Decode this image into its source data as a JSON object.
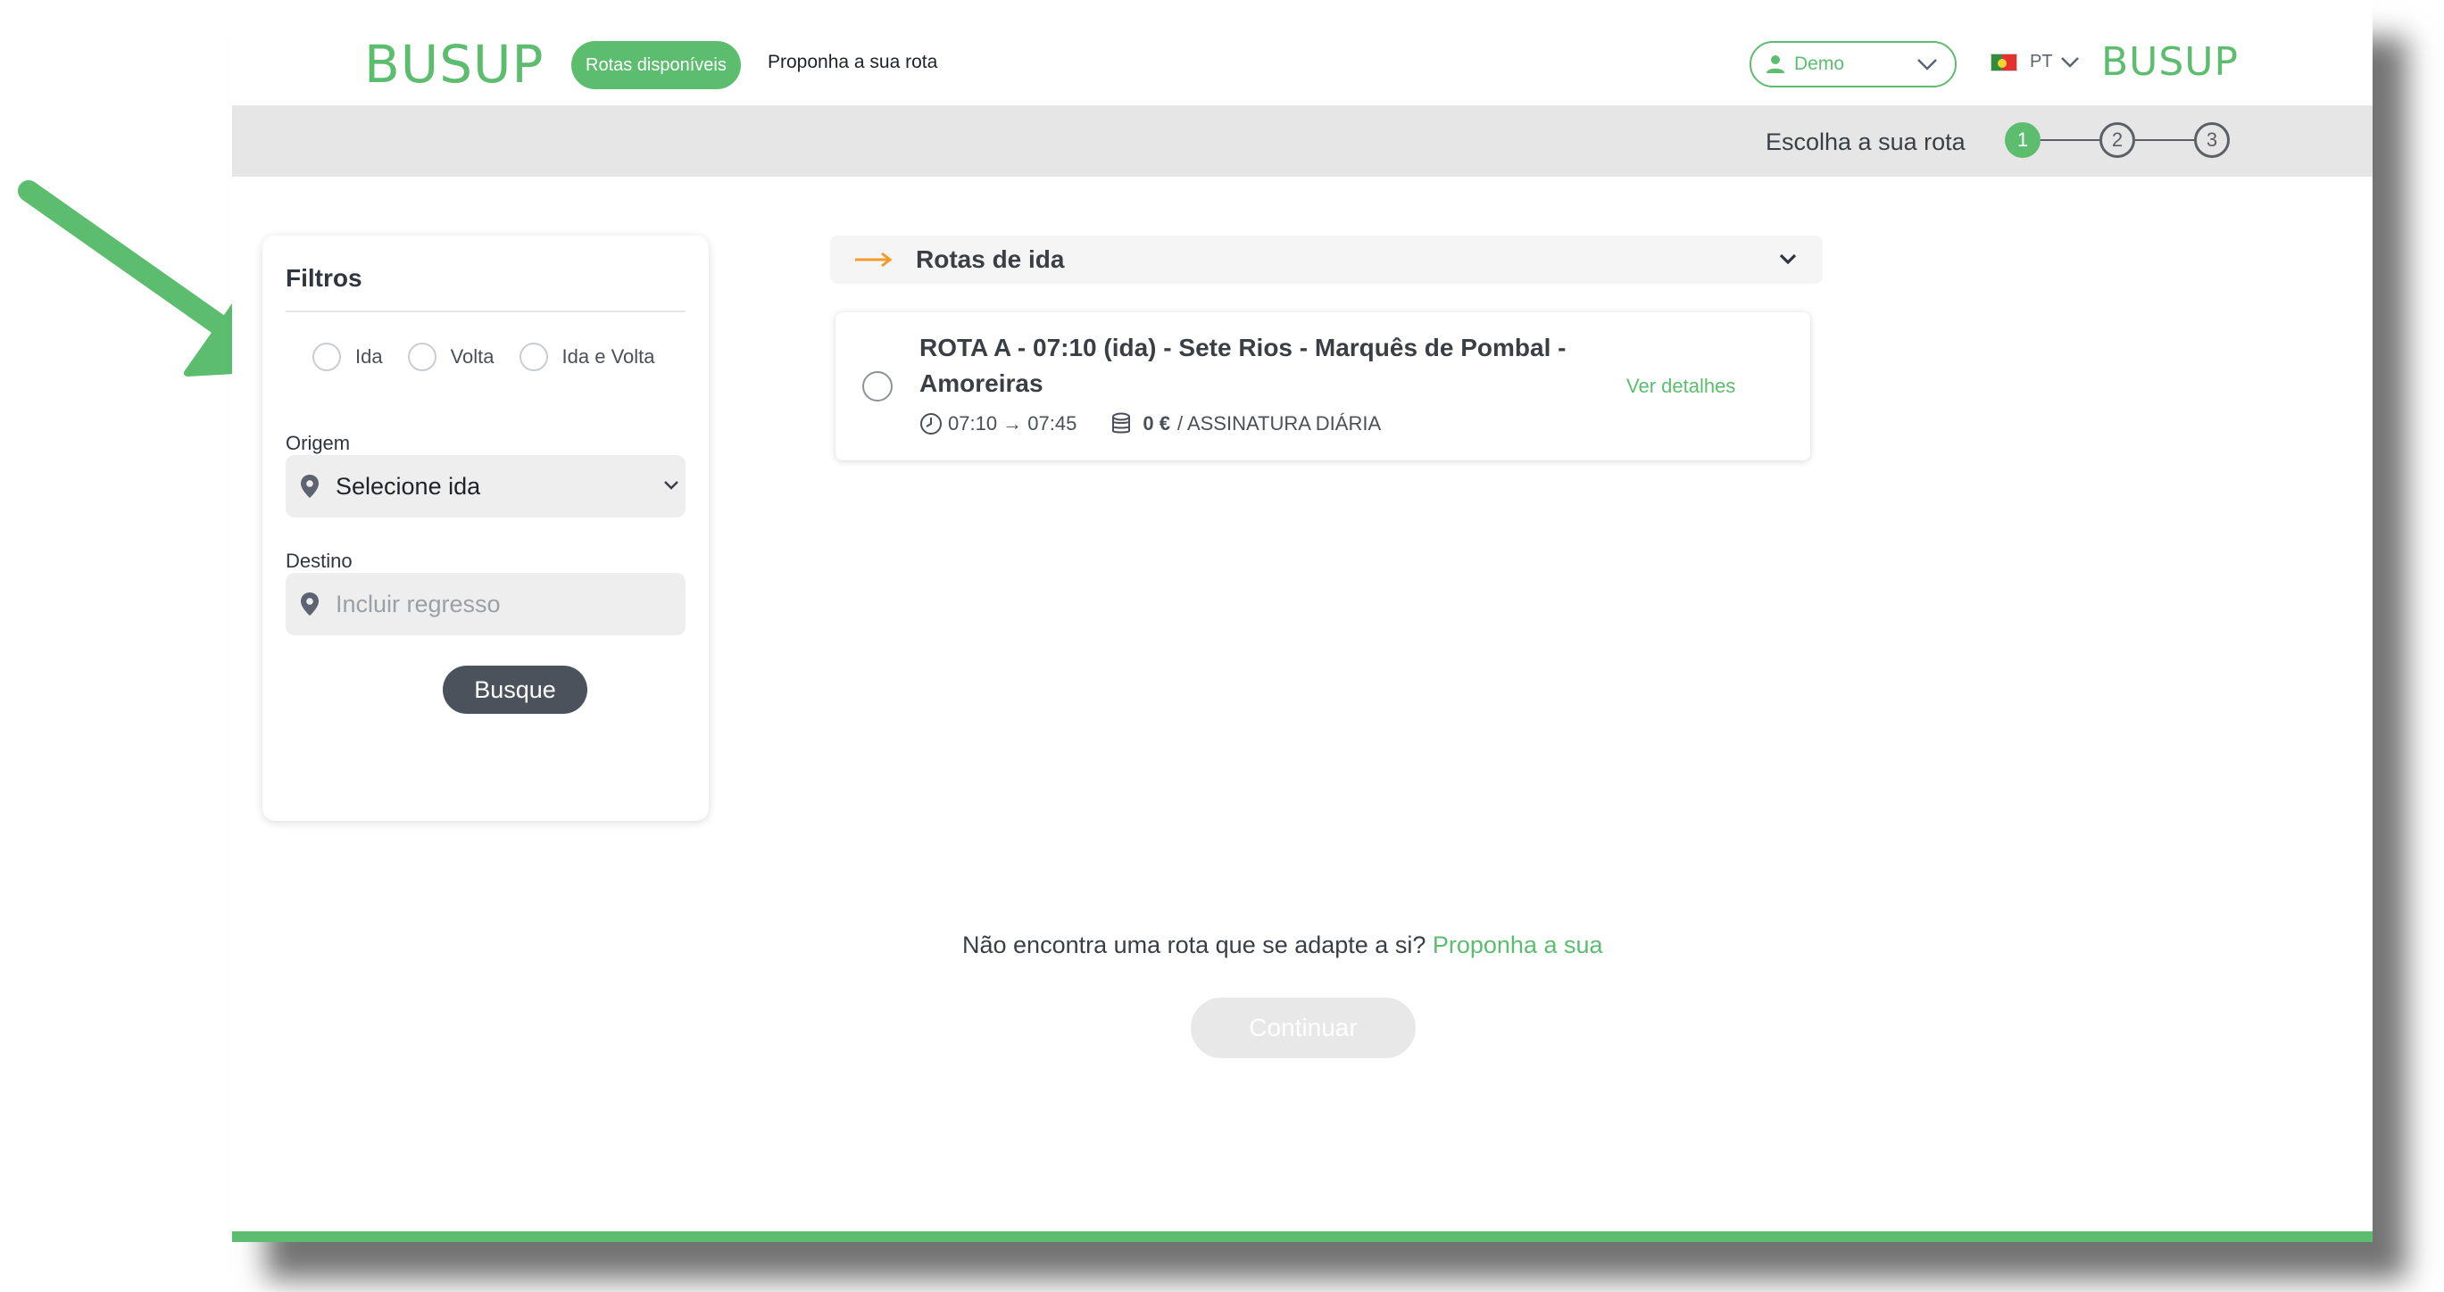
{
  "header": {
    "logo": "BUSUP",
    "nav_active": "Rotas disponíveis",
    "nav_link": "Proponha a sua rota",
    "user": "Demo",
    "language": "PT",
    "logo_right": "BUSUP"
  },
  "stepper": {
    "label": "Escolha a sua rota",
    "steps": [
      "1",
      "2",
      "3"
    ],
    "active_step": 1
  },
  "filters": {
    "title": "Filtros",
    "trip_types": [
      "Ida",
      "Volta",
      "Ida e Volta"
    ],
    "origin_label": "Origem",
    "origin_value": "Selecione ida",
    "destination_label": "Destino",
    "destination_placeholder": "Incluir regresso",
    "search_button": "Busque"
  },
  "routes": {
    "section_title": "Rotas de ida",
    "items": [
      {
        "title": "ROTA A - 07:10 (ida) - Sete Rios - Marquês de Pombal - Amoreiras",
        "time": "07:10 → 07:45",
        "price": "0 €",
        "price_suffix": "/ ASSINATURA DIÁRIA",
        "details_link": "Ver detalhes"
      }
    ]
  },
  "footer": {
    "prompt": "Não encontra uma rota que se adapte a si?",
    "prompt_link": "Proponha a sua",
    "continue_button": "Continuar"
  },
  "colors": {
    "brand_green": "#5cbd6f",
    "annotation_arrow": "#5cbd6f",
    "dark_button": "#4b525c"
  }
}
